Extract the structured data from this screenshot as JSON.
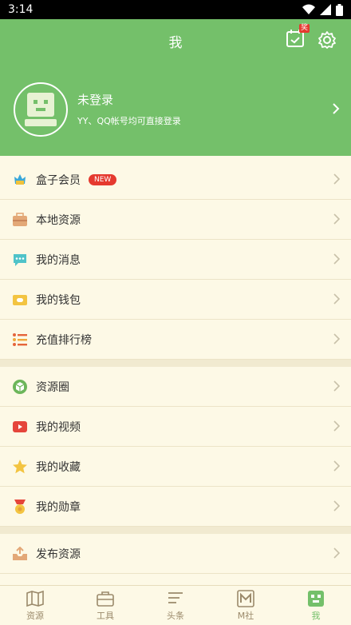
{
  "status": {
    "time": "3:14"
  },
  "header": {
    "title": "我",
    "sign_badge": "奖"
  },
  "profile": {
    "name": "未登录",
    "hint": "YY、QQ帐号均可直接登录"
  },
  "menu": {
    "group1": [
      {
        "label": "盒子会员",
        "badge": "NEW"
      },
      {
        "label": "本地资源"
      },
      {
        "label": "我的消息"
      },
      {
        "label": "我的钱包"
      },
      {
        "label": "充值排行榜"
      }
    ],
    "group2": [
      {
        "label": "资源圈"
      },
      {
        "label": "我的视频"
      },
      {
        "label": "我的收藏"
      },
      {
        "label": "我的勋章"
      }
    ],
    "group3": [
      {
        "label": "发布资源"
      }
    ]
  },
  "tabs": [
    {
      "label": "资源"
    },
    {
      "label": "工具"
    },
    {
      "label": "头条"
    },
    {
      "label": "M社"
    },
    {
      "label": "我",
      "active": true
    }
  ],
  "colors": {
    "brand": "#74c06a",
    "background": "#fdf9e6",
    "badge": "#e53a2f"
  }
}
